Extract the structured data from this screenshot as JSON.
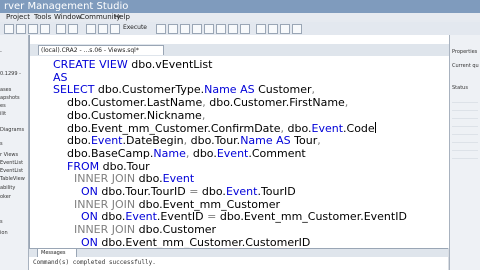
{
  "window": {
    "title": "rver Management Studio"
  },
  "menu": [
    "Project",
    "Tools",
    "Window",
    "Community",
    "Help"
  ],
  "toolbar": {
    "execute_label": "Execute"
  },
  "object_explorer": {
    "items": [
      "-",
      "0.1299 -",
      "ases",
      "apshots",
      "es",
      "ilit",
      "Diagrams",
      "s",
      "r Views",
      "EventList",
      "EventList",
      "TableView",
      "ability",
      "oker",
      "s",
      "ion"
    ]
  },
  "editor": {
    "tab_title": "(local).CRA2 - ...s.06 - Views.sql*",
    "code_lines": [
      [
        {
          "t": "CREATE",
          "c": "kw"
        },
        {
          "t": " ",
          "c": "id"
        },
        {
          "t": "VIEW",
          "c": "kw"
        },
        {
          "t": " dbo.vEventList",
          "c": "id"
        }
      ],
      [
        {
          "t": "AS",
          "c": "kw"
        }
      ],
      [
        {
          "t": "SELECT",
          "c": "kw"
        },
        {
          "t": " dbo.CustomerType.",
          "c": "id"
        },
        {
          "t": "Name",
          "c": "tl"
        },
        {
          "t": " ",
          "c": "id"
        },
        {
          "t": "AS",
          "c": "kw"
        },
        {
          "t": " Customer",
          "c": "id"
        },
        {
          "t": ",",
          "c": "gr"
        }
      ],
      [
        {
          "t": "    dbo.Customer.LastName",
          "c": "id"
        },
        {
          "t": ",",
          "c": "gr"
        },
        {
          "t": " dbo.Customer.FirstName",
          "c": "id"
        },
        {
          "t": ",",
          "c": "gr"
        }
      ],
      [
        {
          "t": "    dbo.Customer.Nickname",
          "c": "id"
        },
        {
          "t": ",",
          "c": "gr"
        }
      ],
      [
        {
          "t": "    dbo.Event_mm_Customer.ConfirmDate",
          "c": "id"
        },
        {
          "t": ",",
          "c": "gr"
        },
        {
          "t": " dbo.",
          "c": "id"
        },
        {
          "t": "Event",
          "c": "tl"
        },
        {
          "t": ".Code",
          "c": "id"
        }
      ],
      [
        {
          "t": "    dbo.",
          "c": "id"
        },
        {
          "t": "Event",
          "c": "tl"
        },
        {
          "t": ".DateBegin",
          "c": "id"
        },
        {
          "t": ",",
          "c": "gr"
        },
        {
          "t": " dbo.Tour.",
          "c": "id"
        },
        {
          "t": "Name",
          "c": "tl"
        },
        {
          "t": " ",
          "c": "id"
        },
        {
          "t": "AS",
          "c": "kw"
        },
        {
          "t": " Tour",
          "c": "id"
        },
        {
          "t": ",",
          "c": "gr"
        }
      ],
      [
        {
          "t": "    dbo.BaseCamp.",
          "c": "id"
        },
        {
          "t": "Name",
          "c": "tl"
        },
        {
          "t": ",",
          "c": "gr"
        },
        {
          "t": " dbo.",
          "c": "id"
        },
        {
          "t": "Event",
          "c": "tl"
        },
        {
          "t": ".Comment",
          "c": "id"
        }
      ],
      [
        {
          "t": "    ",
          "c": "id"
        },
        {
          "t": "FROM",
          "c": "kw"
        },
        {
          "t": " dbo.Tour",
          "c": "id"
        }
      ],
      [
        {
          "t": "      ",
          "c": "id"
        },
        {
          "t": "INNER JOIN",
          "c": "gr"
        },
        {
          "t": " dbo.",
          "c": "id"
        },
        {
          "t": "Event",
          "c": "tl"
        }
      ],
      [
        {
          "t": "        ",
          "c": "id"
        },
        {
          "t": "ON",
          "c": "kw"
        },
        {
          "t": " dbo.Tour.TourID ",
          "c": "id"
        },
        {
          "t": "=",
          "c": "gr"
        },
        {
          "t": " dbo.",
          "c": "id"
        },
        {
          "t": "Event",
          "c": "tl"
        },
        {
          "t": ".TourID",
          "c": "id"
        }
      ],
      [
        {
          "t": "      ",
          "c": "id"
        },
        {
          "t": "INNER JOIN",
          "c": "gr"
        },
        {
          "t": " dbo.Event_mm_Customer",
          "c": "id"
        }
      ],
      [
        {
          "t": "        ",
          "c": "id"
        },
        {
          "t": "ON",
          "c": "kw"
        },
        {
          "t": " dbo.",
          "c": "id"
        },
        {
          "t": "Event",
          "c": "tl"
        },
        {
          "t": ".EventID ",
          "c": "id"
        },
        {
          "t": "=",
          "c": "gr"
        },
        {
          "t": " dbo.Event_mm_Customer.EventID",
          "c": "id"
        }
      ],
      [
        {
          "t": "      ",
          "c": "id"
        },
        {
          "t": "INNER JOIN",
          "c": "gr"
        },
        {
          "t": " dbo.Customer",
          "c": "id"
        }
      ],
      [
        {
          "t": "        ",
          "c": "id"
        },
        {
          "t": "ON",
          "c": "kw"
        },
        {
          "t": " dbo.Event_mm_Customer.CustomerID",
          "c": "id"
        }
      ]
    ]
  },
  "results": {
    "tab_label": "Messages",
    "message": "Command(s) completed successfully."
  },
  "properties": {
    "title": "Properties",
    "subtitle": "Current qu",
    "section": "Status",
    "rows": [
      "",
      "",
      "",
      "",
      "",
      "",
      "",
      ""
    ]
  },
  "colors": {
    "keyword": "#0000d8",
    "operator": "#808080",
    "text": "#000000"
  }
}
